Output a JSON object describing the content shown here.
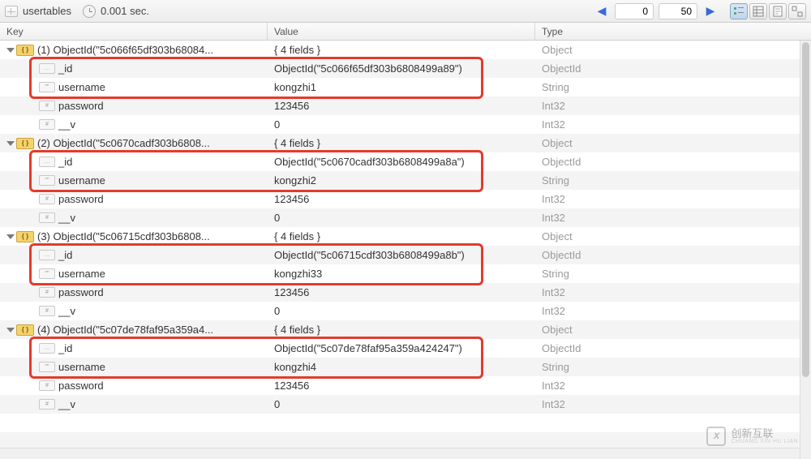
{
  "toolbar": {
    "table_name": "usertables",
    "duration": "0.001 sec.",
    "page_start": "0",
    "page_size": "50"
  },
  "headers": {
    "key": "Key",
    "value": "Value",
    "type": "Type"
  },
  "types": {
    "object": "Object",
    "objectid": "ObjectId",
    "string": "String",
    "int32": "Int32"
  },
  "docs": [
    {
      "idx_label": "(1) ObjectId(\"5c066f65df303b68084...",
      "value_label": "{ 4 fields }",
      "fields": {
        "_id": {
          "key": "_id",
          "value": "ObjectId(\"5c066f65df303b6808499a89\")",
          "type": "objectid",
          "badge": "…"
        },
        "username": {
          "key": "username",
          "value": "kongzhi1",
          "type": "string",
          "badge": "\"\""
        },
        "password": {
          "key": "password",
          "value": "123456",
          "type": "int32",
          "badge": "#"
        },
        "__v": {
          "key": "__v",
          "value": "0",
          "type": "int32",
          "badge": "#"
        }
      }
    },
    {
      "idx_label": "(2) ObjectId(\"5c0670cadf303b6808...",
      "value_label": "{ 4 fields }",
      "fields": {
        "_id": {
          "key": "_id",
          "value": "ObjectId(\"5c0670cadf303b6808499a8a\")",
          "type": "objectid",
          "badge": "…"
        },
        "username": {
          "key": "username",
          "value": "kongzhi2",
          "type": "string",
          "badge": "\"\""
        },
        "password": {
          "key": "password",
          "value": "123456",
          "type": "int32",
          "badge": "#"
        },
        "__v": {
          "key": "__v",
          "value": "0",
          "type": "int32",
          "badge": "#"
        }
      }
    },
    {
      "idx_label": "(3) ObjectId(\"5c06715cdf303b6808...",
      "value_label": "{ 4 fields }",
      "fields": {
        "_id": {
          "key": "_id",
          "value": "ObjectId(\"5c06715cdf303b6808499a8b\")",
          "type": "objectid",
          "badge": "…"
        },
        "username": {
          "key": "username",
          "value": "kongzhi33",
          "type": "string",
          "badge": "\"\""
        },
        "password": {
          "key": "password",
          "value": "123456",
          "type": "int32",
          "badge": "#"
        },
        "__v": {
          "key": "__v",
          "value": "0",
          "type": "int32",
          "badge": "#"
        }
      }
    },
    {
      "idx_label": "(4) ObjectId(\"5c07de78faf95a359a4...",
      "value_label": "{ 4 fields }",
      "fields": {
        "_id": {
          "key": "_id",
          "value": "ObjectId(\"5c07de78faf95a359a424247\")",
          "type": "objectid",
          "badge": "…"
        },
        "username": {
          "key": "username",
          "value": "kongzhi4",
          "type": "string",
          "badge": "\"\""
        },
        "password": {
          "key": "password",
          "value": "123456",
          "type": "int32",
          "badge": "#"
        },
        "__v": {
          "key": "__v",
          "value": "0",
          "type": "int32",
          "badge": "#"
        }
      }
    }
  ],
  "watermark": {
    "brand": "创新互联",
    "sub": "CHUANG XIN HU LIAN",
    "logo": "X"
  }
}
